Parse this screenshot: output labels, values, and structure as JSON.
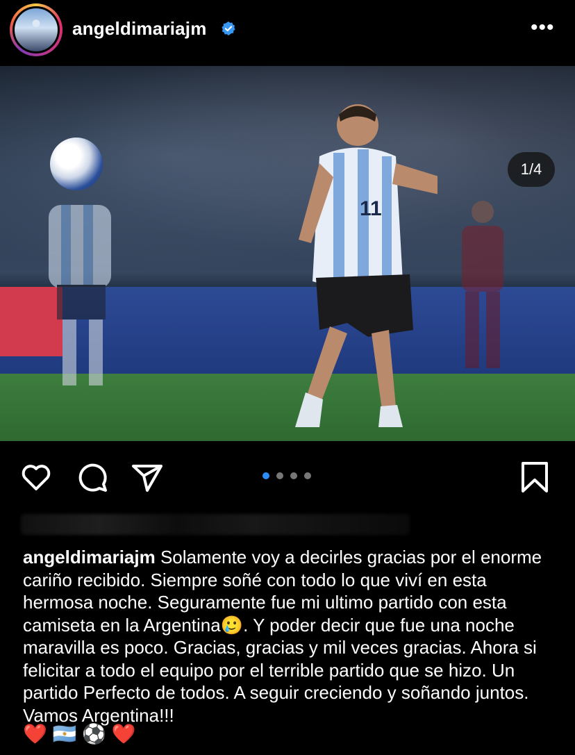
{
  "post": {
    "username": "angeldimariajm",
    "verified": true,
    "slide_counter": "1/4",
    "slide_total": 4,
    "active_slide": 1
  },
  "caption": {
    "username": "angeldimariajm",
    "text": "Solamente voy a decirles gracias por el enorme cariño recibido. Siempre soñé con todo lo que viví en esta hermosa noche. Seguramente fue mi ultimo partido con esta camiseta en la Argentina",
    "emoji_inline": "🥲",
    "text_after": ". Y poder decir que fue una noche maravilla es poco. Gracias, gracias y mil veces gracias. Ahora si felicitar a todo el equipo por el terrible partido que se hizo. Un partido Perfecto de todos. A seguir creciendo y soñando juntos. Vamos Argentina!!!",
    "emoji_line": "❤️ 🇦🇷 ⚽ ❤️"
  },
  "icons": {
    "more": "more-options-icon",
    "like": "heart-icon",
    "comment": "comment-icon",
    "share": "send-icon",
    "save": "bookmark-icon",
    "verified": "verified-badge-icon"
  },
  "colors": {
    "background": "#000000",
    "accent_blue": "#2a8cf7",
    "verified_blue": "#3897f0"
  }
}
